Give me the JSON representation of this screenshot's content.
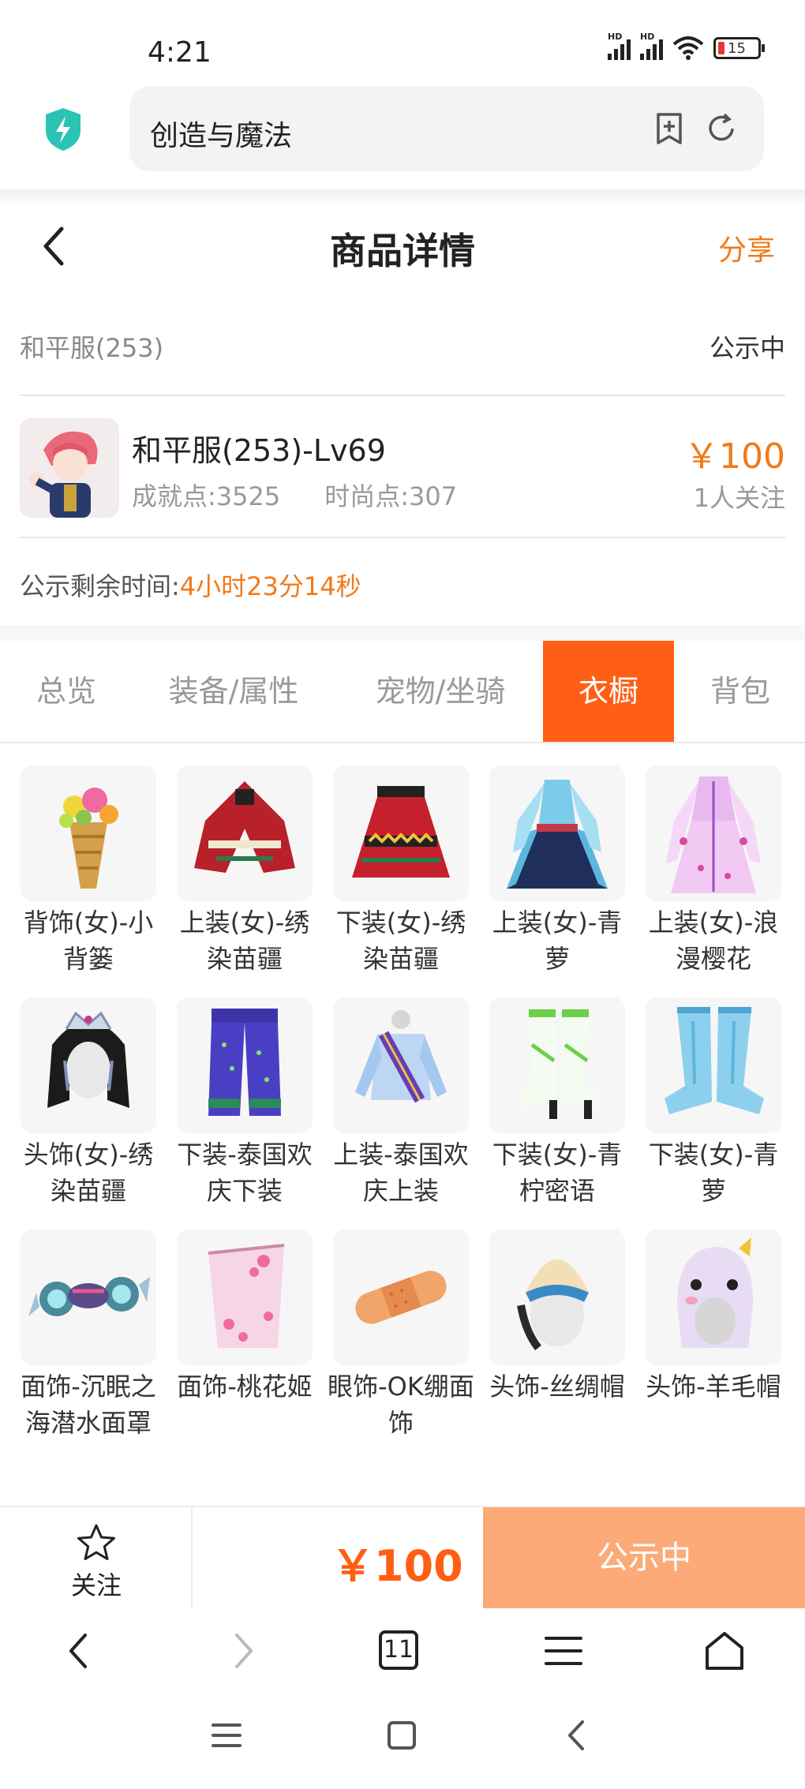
{
  "status_bar": {
    "time": "4:21",
    "battery": "15"
  },
  "browser": {
    "url_text": "创造与魔法"
  },
  "header": {
    "title": "商品详情",
    "share": "分享"
  },
  "listing": {
    "server": "和平服(253)",
    "status": "公示中",
    "name": "和平服(253)-Lv69",
    "achievement": "成就点:3525",
    "fashion": "时尚点:307",
    "price": "￥100",
    "followers": "1人关注",
    "remain_label": "公示剩余时间:",
    "remain_value": "4小时23分14秒"
  },
  "tabs": [
    "总览",
    "装备/属性",
    "宠物/坐骑",
    "衣橱",
    "背包"
  ],
  "active_tab": "衣橱",
  "wardrobe": [
    {
      "label": "背饰(女)-小背篓",
      "icon": "basket-icon"
    },
    {
      "label": "上装(女)-绣染苗疆",
      "icon": "embroidered-top-icon"
    },
    {
      "label": "下装(女)-绣染苗疆",
      "icon": "embroidered-skirt-icon"
    },
    {
      "label": "上装(女)-青萝",
      "icon": "blue-dress-icon"
    },
    {
      "label": "上装(女)-浪漫樱花",
      "icon": "pink-dress-icon"
    },
    {
      "label": "头饰(女)-绣染苗疆",
      "icon": "headdress-icon"
    },
    {
      "label": "下装-泰国欢庆下装",
      "icon": "thai-pants-icon"
    },
    {
      "label": "上装-泰国欢庆上装",
      "icon": "thai-top-icon"
    },
    {
      "label": "下装(女)-青柠密语",
      "icon": "green-boots-icon"
    },
    {
      "label": "下装(女)-青萝",
      "icon": "blue-boots-icon"
    },
    {
      "label": "面饰-沉眠之海潜水面罩",
      "icon": "diving-mask-icon"
    },
    {
      "label": "面饰-桃花姬",
      "icon": "peach-veil-icon"
    },
    {
      "label": "眼饰-OK绷面饰",
      "icon": "bandage-icon"
    },
    {
      "label": "头饰-丝绸帽",
      "icon": "silk-hat-icon"
    },
    {
      "label": "头饰-羊毛帽",
      "icon": "wool-hat-icon"
    }
  ],
  "action_bar": {
    "follow": "关注",
    "price": "￥100",
    "buy": "公示中"
  },
  "browser_nav": {
    "tab_count": "11"
  },
  "colors": {
    "accent": "#ff5f14",
    "price": "#f07a1a",
    "buy_button": "#fbaa78"
  }
}
